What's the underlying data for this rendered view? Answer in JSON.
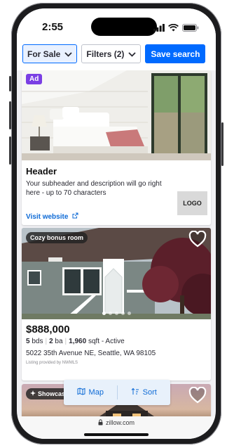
{
  "status_bar": {
    "time": "2:55"
  },
  "toolbar": {
    "for_sale_label": "For Sale",
    "filters_label": "Filters (2)",
    "save_search_label": "Save search"
  },
  "ad_card": {
    "badge": "Ad",
    "header": "Header",
    "subheader": "Your subheader and description will go right here - up to 70 characters",
    "logo_label": "LOGO",
    "visit_label": "Visit website"
  },
  "listing": {
    "tag": "Cozy bonus room",
    "price": "$888,000",
    "beds": "5",
    "beds_unit": "bds",
    "baths": "2",
    "baths_unit": "ba",
    "sqft": "1,960",
    "sqft_unit": "sqft",
    "status": "- Active",
    "address": "5022 35th Avenue NE, Seattle, WA 98105",
    "provider": "Listing provided by NWMLS",
    "photo_count": 5,
    "active_photo": 1
  },
  "listing2": {
    "tag": "Showcase"
  },
  "float_bar": {
    "map_label": "Map",
    "sort_label": "Sort"
  },
  "browser": {
    "url": "zillow.com"
  },
  "colors": {
    "accent": "#006aff",
    "ad_badge": "#7a3fe4",
    "link": "#0d6ad6"
  }
}
